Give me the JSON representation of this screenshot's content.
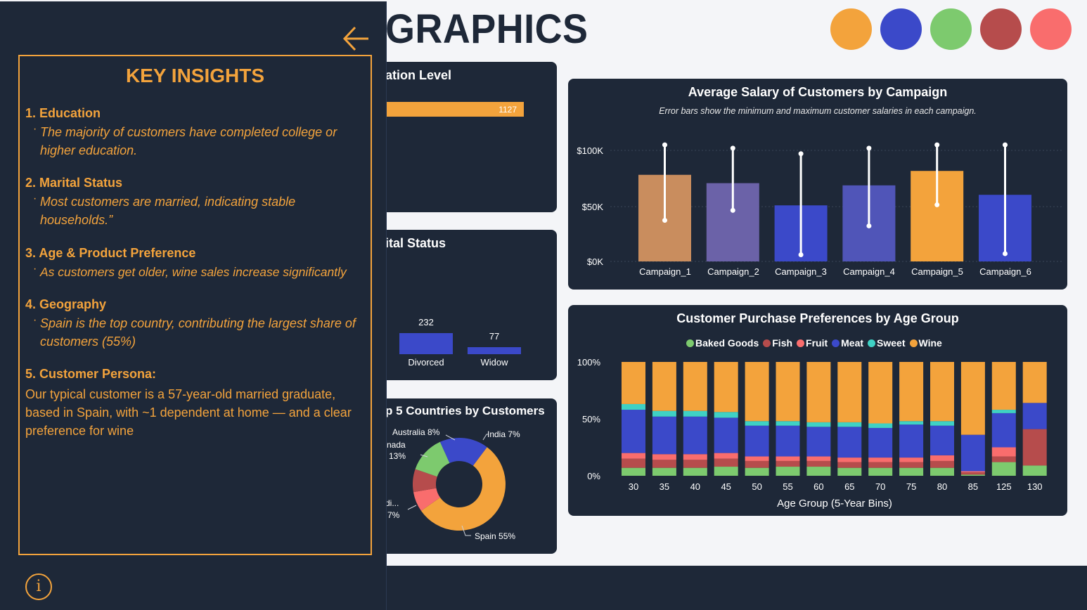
{
  "header": {
    "title_fragment": "GRAPHICS"
  },
  "theme_colors": [
    "#f3a33c",
    "#3b49c9",
    "#7dca6e",
    "#b64c4c",
    "#f96d6d"
  ],
  "education_card": {
    "title_fragment": "ation Level",
    "bar_value": "1127"
  },
  "marital_card": {
    "title_fragment": "ital Status",
    "bars": [
      {
        "label": "Divorced",
        "value": "232"
      },
      {
        "label": "Widow",
        "value": "77"
      }
    ]
  },
  "countries_card": {
    "title_fragment": "p 5 Countries by Customers",
    "labels": [
      {
        "text": "Australia 8%"
      },
      {
        "text": "India 7%"
      },
      {
        "text": "nada"
      },
      {
        "text": "13%"
      },
      {
        "text": "di..."
      },
      {
        "text": "7%"
      },
      {
        "text": "Spain 55%"
      }
    ]
  },
  "salary_card": {
    "title": "Average Salary of Customers by Campaign",
    "subtitle": "Error bars show the minimum and maximum customer salaries in each campaign.",
    "y_ticks": [
      "$100K",
      "$50K",
      "$0K"
    ],
    "categories": [
      "Campaign_1",
      "Campaign_2",
      "Campaign_3",
      "Campaign_4",
      "Campaign_5",
      "Campaign_6"
    ]
  },
  "purchase_card": {
    "title": "Customer Purchase Preferences by Age Group",
    "legend": [
      {
        "label": "Baked Goods",
        "color": "#7dca6e"
      },
      {
        "label": "Fish",
        "color": "#b64c4c"
      },
      {
        "label": "Fruit",
        "color": "#f96d6d"
      },
      {
        "label": "Meat",
        "color": "#3b49c9"
      },
      {
        "label": "Sweet",
        "color": "#3fd1c4"
      },
      {
        "label": "Wine",
        "color": "#f3a33c"
      }
    ],
    "y_ticks": [
      "100%",
      "50%",
      "0%"
    ],
    "xlabel": "Age Group (5-Year Bins)"
  },
  "insights": {
    "title": "KEY INSIGHTS",
    "items": [
      {
        "heading": "1. Education",
        "body": "The majority of customers have completed college or higher education."
      },
      {
        "heading": "2. Marital Status",
        "body": "Most customers are married, indicating stable households.”"
      },
      {
        "heading": "3. Age & Product Preference",
        "body": "As customers get older, wine sales increase significantly"
      },
      {
        "heading": "4. Geography",
        "body": "Spain is the top country, contributing the largest share of customers  (55%)"
      },
      {
        "heading": "5. Customer Persona:",
        "body": "Our typical customer is a 57-year-old married graduate, based in Spain, with ~1 dependent at home — and a clear preference for wine"
      }
    ],
    "info_symbol": "i"
  },
  "chart_data": [
    {
      "type": "bar",
      "title": "Average Salary of Customers by Campaign",
      "categories": [
        "Campaign_1",
        "Campaign_2",
        "Campaign_3",
        "Campaign_4",
        "Campaign_5",
        "Campaign_6"
      ],
      "values": [
        78000,
        70500,
        50500,
        68500,
        81500,
        60000
      ],
      "error_min": [
        37000,
        46000,
        6000,
        32000,
        51000,
        7000
      ],
      "error_max": [
        105000,
        102000,
        97000,
        102000,
        105000,
        105000
      ],
      "ylim": [
        0,
        110000
      ],
      "colors": [
        "#c98d5e",
        "#6b62a8",
        "#3b49c9",
        "#5055b8",
        "#f3a33c",
        "#3b49c9"
      ]
    },
    {
      "type": "bar",
      "stacked": true,
      "title": "Customer Purchase Preferences by Age Group",
      "xlabel": "Age Group (5-Year Bins)",
      "categories": [
        "30",
        "35",
        "40",
        "45",
        "50",
        "55",
        "60",
        "65",
        "70",
        "75",
        "80",
        "85",
        "125",
        "130"
      ],
      "series": [
        {
          "name": "Baked Goods",
          "color": "#7dca6e",
          "values": [
            7,
            7,
            7,
            8,
            7,
            8,
            8,
            7,
            7,
            7,
            7,
            1,
            12,
            9
          ]
        },
        {
          "name": "Fish",
          "color": "#b64c4c",
          "values": [
            8,
            7,
            7,
            7,
            6,
            5,
            5,
            5,
            5,
            5,
            6,
            2,
            5,
            32
          ]
        },
        {
          "name": "Fruit",
          "color": "#f96d6d",
          "values": [
            5,
            5,
            5,
            5,
            4,
            4,
            4,
            4,
            4,
            4,
            5,
            1,
            8,
            0
          ]
        },
        {
          "name": "Meat",
          "color": "#3b49c9",
          "values": [
            38,
            33,
            33,
            31,
            27,
            27,
            26,
            27,
            26,
            29,
            26,
            32,
            30,
            23
          ]
        },
        {
          "name": "Sweet",
          "color": "#3fd1c4",
          "values": [
            5,
            5,
            5,
            5,
            4,
            4,
            4,
            4,
            4,
            3,
            4,
            0,
            3,
            0
          ]
        },
        {
          "name": "Wine",
          "color": "#f3a33c",
          "values": [
            37,
            43,
            43,
            44,
            52,
            52,
            53,
            53,
            54,
            52,
            52,
            64,
            42,
            36
          ]
        }
      ],
      "ylim": [
        0,
        100
      ]
    },
    {
      "type": "pie",
      "title": "Top 5 Countries by Customers",
      "slices": [
        {
          "label": "Spain",
          "value": 55,
          "color": "#f3a33c"
        },
        {
          "label": "India",
          "value": 7,
          "color": "#f96d6d"
        },
        {
          "label": "Australia",
          "value": 8,
          "color": "#b64c4c"
        },
        {
          "label": "Canada",
          "value": 13,
          "color": "#7dca6e"
        },
        {
          "label": "di...",
          "value": 17,
          "color": "#3b49c9"
        }
      ]
    }
  ]
}
